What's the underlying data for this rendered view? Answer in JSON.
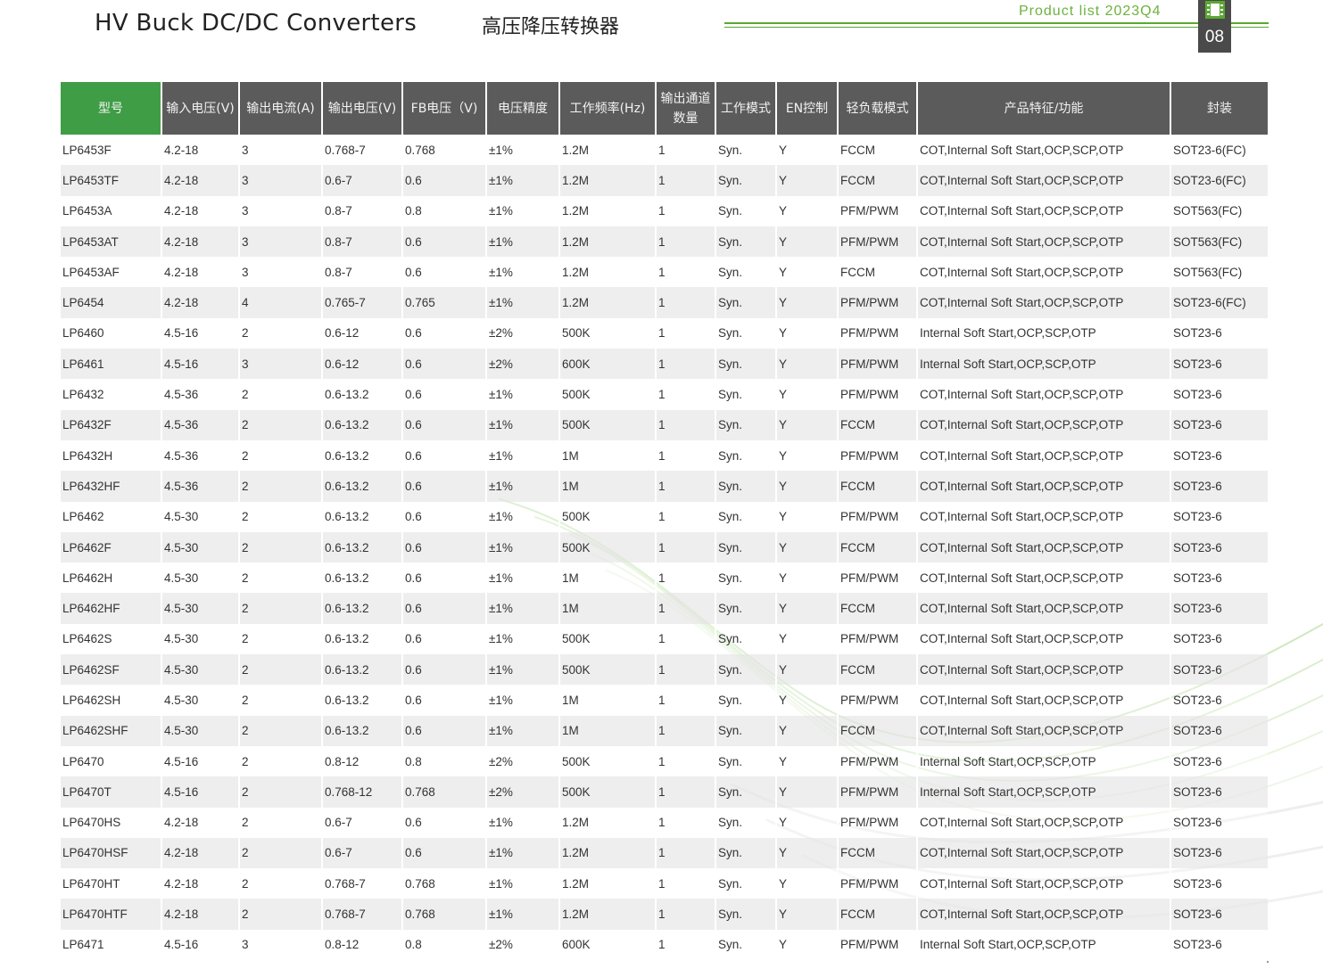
{
  "header": {
    "title_en": "HV Buck DC/DC Converters",
    "title_cn": "高压降压转换器",
    "product_list": "Product list 2023Q4",
    "page_number": "08",
    "accent_color": "#3f9d45",
    "line_color": "#5aa832",
    "icon": "chip-icon"
  },
  "table": {
    "columns": [
      "型号",
      "输入电压(V)",
      "输出电流(A)",
      "输出电压(V)",
      "FB电压（V)",
      "电压精度",
      "工作频率(Hz)",
      "输出通道数量",
      "工作模式",
      "EN控制",
      "轻负载模式",
      "产品特征/功能",
      "封装"
    ],
    "rows": [
      [
        "LP6453F",
        "4.2-18",
        "3",
        "0.768-7",
        "0.768",
        "±1%",
        "1.2M",
        "1",
        "Syn.",
        "Y",
        "FCCM",
        "COT,Internal Soft Start,OCP,SCP,OTP",
        "SOT23-6(FC)"
      ],
      [
        "LP6453TF",
        "4.2-18",
        "3",
        "0.6-7",
        "0.6",
        "±1%",
        "1.2M",
        "1",
        "Syn.",
        "Y",
        "FCCM",
        "COT,Internal Soft Start,OCP,SCP,OTP",
        "SOT23-6(FC)"
      ],
      [
        "LP6453A",
        "4.2-18",
        "3",
        "0.8-7",
        "0.8",
        "±1%",
        "1.2M",
        "1",
        "Syn.",
        "Y",
        "PFM/PWM",
        "COT,Internal Soft Start,OCP,SCP,OTP",
        "SOT563(FC)"
      ],
      [
        "LP6453AT",
        "4.2-18",
        "3",
        "0.8-7",
        "0.6",
        "±1%",
        "1.2M",
        "1",
        "Syn.",
        "Y",
        "PFM/PWM",
        "COT,Internal Soft Start,OCP,SCP,OTP",
        "SOT563(FC)"
      ],
      [
        "LP6453AF",
        "4.2-18",
        "3",
        "0.8-7",
        "0.6",
        "±1%",
        "1.2M",
        "1",
        "Syn.",
        "Y",
        "FCCM",
        "COT,Internal Soft Start,OCP,SCP,OTP",
        "SOT563(FC)"
      ],
      [
        "LP6454",
        "4.2-18",
        "4",
        "0.765-7",
        "0.765",
        "±1%",
        "1.2M",
        "1",
        "Syn.",
        "Y",
        "PFM/PWM",
        "COT,Internal Soft Start,OCP,SCP,OTP",
        "SOT23-6(FC)"
      ],
      [
        "LP6460",
        "4.5-16",
        "2",
        "0.6-12",
        "0.6",
        "±2%",
        "500K",
        "1",
        "Syn.",
        "Y",
        "PFM/PWM",
        "Internal Soft Start,OCP,SCP,OTP",
        "SOT23-6"
      ],
      [
        "LP6461",
        "4.5-16",
        "3",
        "0.6-12",
        "0.6",
        "±2%",
        "600K",
        "1",
        "Syn.",
        "Y",
        "PFM/PWM",
        "Internal Soft Start,OCP,SCP,OTP",
        "SOT23-6"
      ],
      [
        "LP6432",
        "4.5-36",
        "2",
        "0.6-13.2",
        "0.6",
        "±1%",
        "500K",
        "1",
        "Syn.",
        "Y",
        "PFM/PWM",
        "COT,Internal Soft Start,OCP,SCP,OTP",
        "SOT23-6"
      ],
      [
        "LP6432F",
        "4.5-36",
        "2",
        "0.6-13.2",
        "0.6",
        "±1%",
        "500K",
        "1",
        "Syn.",
        "Y",
        "FCCM",
        "COT,Internal Soft Start,OCP,SCP,OTP",
        "SOT23-6"
      ],
      [
        "LP6432H",
        "4.5-36",
        "2",
        "0.6-13.2",
        "0.6",
        "±1%",
        "1M",
        "1",
        "Syn.",
        "Y",
        "PFM/PWM",
        "COT,Internal Soft Start,OCP,SCP,OTP",
        "SOT23-6"
      ],
      [
        "LP6432HF",
        "4.5-36",
        "2",
        "0.6-13.2",
        "0.6",
        "±1%",
        "1M",
        "1",
        "Syn.",
        "Y",
        "FCCM",
        "COT,Internal Soft Start,OCP,SCP,OTP",
        "SOT23-6"
      ],
      [
        "LP6462",
        "4.5-30",
        "2",
        "0.6-13.2",
        "0.6",
        "±1%",
        "500K",
        "1",
        "Syn.",
        "Y",
        "PFM/PWM",
        "COT,Internal Soft Start,OCP,SCP,OTP",
        "SOT23-6"
      ],
      [
        "LP6462F",
        "4.5-30",
        "2",
        "0.6-13.2",
        "0.6",
        "±1%",
        "500K",
        "1",
        "Syn.",
        "Y",
        "FCCM",
        "COT,Internal Soft Start,OCP,SCP,OTP",
        "SOT23-6"
      ],
      [
        "LP6462H",
        "4.5-30",
        "2",
        "0.6-13.2",
        "0.6",
        "±1%",
        "1M",
        "1",
        "Syn.",
        "Y",
        "PFM/PWM",
        "COT,Internal Soft Start,OCP,SCP,OTP",
        "SOT23-6"
      ],
      [
        "LP6462HF",
        "4.5-30",
        "2",
        "0.6-13.2",
        "0.6",
        "±1%",
        "1M",
        "1",
        "Syn.",
        "Y",
        "FCCM",
        "COT,Internal Soft Start,OCP,SCP,OTP",
        "SOT23-6"
      ],
      [
        "LP6462S",
        "4.5-30",
        "2",
        "0.6-13.2",
        "0.6",
        "±1%",
        "500K",
        "1",
        "Syn.",
        "Y",
        "PFM/PWM",
        "COT,Internal Soft Start,OCP,SCP,OTP",
        "SOT23-6"
      ],
      [
        "LP6462SF",
        "4.5-30",
        "2",
        "0.6-13.2",
        "0.6",
        "±1%",
        "500K",
        "1",
        "Syn.",
        "Y",
        "FCCM",
        "COT,Internal Soft Start,OCP,SCP,OTP",
        "SOT23-6"
      ],
      [
        "LP6462SH",
        "4.5-30",
        "2",
        "0.6-13.2",
        "0.6",
        "±1%",
        "1M",
        "1",
        "Syn.",
        "Y",
        "PFM/PWM",
        "COT,Internal Soft Start,OCP,SCP,OTP",
        "SOT23-6"
      ],
      [
        "LP6462SHF",
        "4.5-30",
        "2",
        "0.6-13.2",
        "0.6",
        "±1%",
        "1M",
        "1",
        "Syn.",
        "Y",
        "FCCM",
        "COT,Internal Soft Start,OCP,SCP,OTP",
        "SOT23-6"
      ],
      [
        "LP6470",
        "4.5-16",
        "2",
        "0.8-12",
        "0.8",
        "±2%",
        "500K",
        "1",
        "Syn.",
        "Y",
        "PFM/PWM",
        "Internal Soft Start,OCP,SCP,OTP",
        "SOT23-6"
      ],
      [
        "LP6470T",
        "4.5-16",
        "2",
        "0.768-12",
        "0.768",
        "±2%",
        "500K",
        "1",
        "Syn.",
        "Y",
        "PFM/PWM",
        "Internal Soft Start,OCP,SCP,OTP",
        "SOT23-6"
      ],
      [
        "LP6470HS",
        "4.2-18",
        "2",
        "0.6-7",
        "0.6",
        "±1%",
        "1.2M",
        "1",
        "Syn.",
        "Y",
        "PFM/PWM",
        "COT,Internal Soft Start,OCP,SCP,OTP",
        "SOT23-6"
      ],
      [
        "LP6470HSF",
        "4.2-18",
        "2",
        "0.6-7",
        "0.6",
        "±1%",
        "1.2M",
        "1",
        "Syn.",
        "Y",
        "FCCM",
        "COT,Internal Soft Start,OCP,SCP,OTP",
        "SOT23-6"
      ],
      [
        "LP6470HT",
        "4.2-18",
        "2",
        "0.768-7",
        "0.768",
        "±1%",
        "1.2M",
        "1",
        "Syn.",
        "Y",
        "PFM/PWM",
        "COT,Internal Soft Start,OCP,SCP,OTP",
        "SOT23-6"
      ],
      [
        "LP6470HTF",
        "4.2-18",
        "2",
        "0.768-7",
        "0.768",
        "±1%",
        "1.2M",
        "1",
        "Syn.",
        "Y",
        "FCCM",
        "COT,Internal Soft Start,OCP,SCP,OTP",
        "SOT23-6"
      ],
      [
        "LP6471",
        "4.5-16",
        "3",
        "0.8-12",
        "0.8",
        "±2%",
        "600K",
        "1",
        "Syn.",
        "Y",
        "PFM/PWM",
        "Internal Soft Start,OCP,SCP,OTP",
        "SOT23-6"
      ]
    ]
  }
}
